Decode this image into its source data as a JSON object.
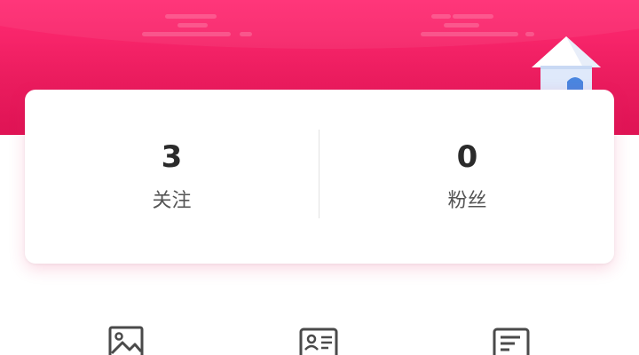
{
  "stats": {
    "following": {
      "value": "3",
      "label": "关注"
    },
    "followers": {
      "value": "0",
      "label": "粉丝"
    }
  },
  "quick_actions": [
    {
      "icon": "image-icon"
    },
    {
      "icon": "id-card-icon"
    },
    {
      "icon": "document-list-icon"
    }
  ],
  "colors": {
    "banner": "#f01f62",
    "card": "#ffffff",
    "text_primary": "#2b2b2b",
    "text_secondary": "#555555"
  }
}
